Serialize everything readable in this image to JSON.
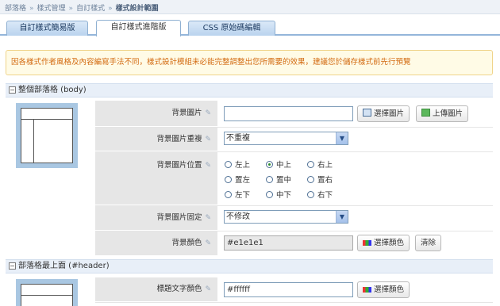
{
  "breadcrumb": [
    "部落格",
    "樣式管理",
    "自訂樣式",
    "樣式設計範圍"
  ],
  "tabs": [
    {
      "label": "自訂樣式簡易版",
      "active": false
    },
    {
      "label": "自訂樣式進階版",
      "active": true
    },
    {
      "label": "CSS 原始碼編輯",
      "active": false
    }
  ],
  "notice": "因各樣式作者風格及內容編寫手法不同，樣式設計模組未必能完整調整出您所需要的效果，建議您於儲存樣式前先行預覽",
  "section_body": {
    "title": "整個部落格 (body)",
    "rows": {
      "bg_image": {
        "label": "背景圖片",
        "value": "",
        "select_label": "選擇圖片",
        "upload_label": "上傳圖片"
      },
      "bg_repeat": {
        "label": "背景圖片重複",
        "selected": "不重複"
      },
      "bg_position": {
        "label": "背景圖片位置",
        "options": [
          "左上",
          "中上",
          "右上",
          "置左",
          "置中",
          "置右",
          "左下",
          "中下",
          "右下"
        ],
        "selected": "中上"
      },
      "bg_fixed": {
        "label": "背景圖片固定",
        "selected": "不修改"
      },
      "bg_color": {
        "label": "背景顏色",
        "value": "#e1e1e1",
        "pick_label": "選擇顏色",
        "clear_label": "清除"
      }
    }
  },
  "section_header": {
    "title": "部落格最上面 (#header)",
    "rows": {
      "title_color": {
        "label": "標題文字顏色",
        "value": "#ffffff",
        "pick_label": "選擇顏色"
      }
    }
  },
  "colors": {
    "accent": "#94b6da",
    "notice_text": "#d36b12",
    "notice_bg": "#fffbe6"
  }
}
